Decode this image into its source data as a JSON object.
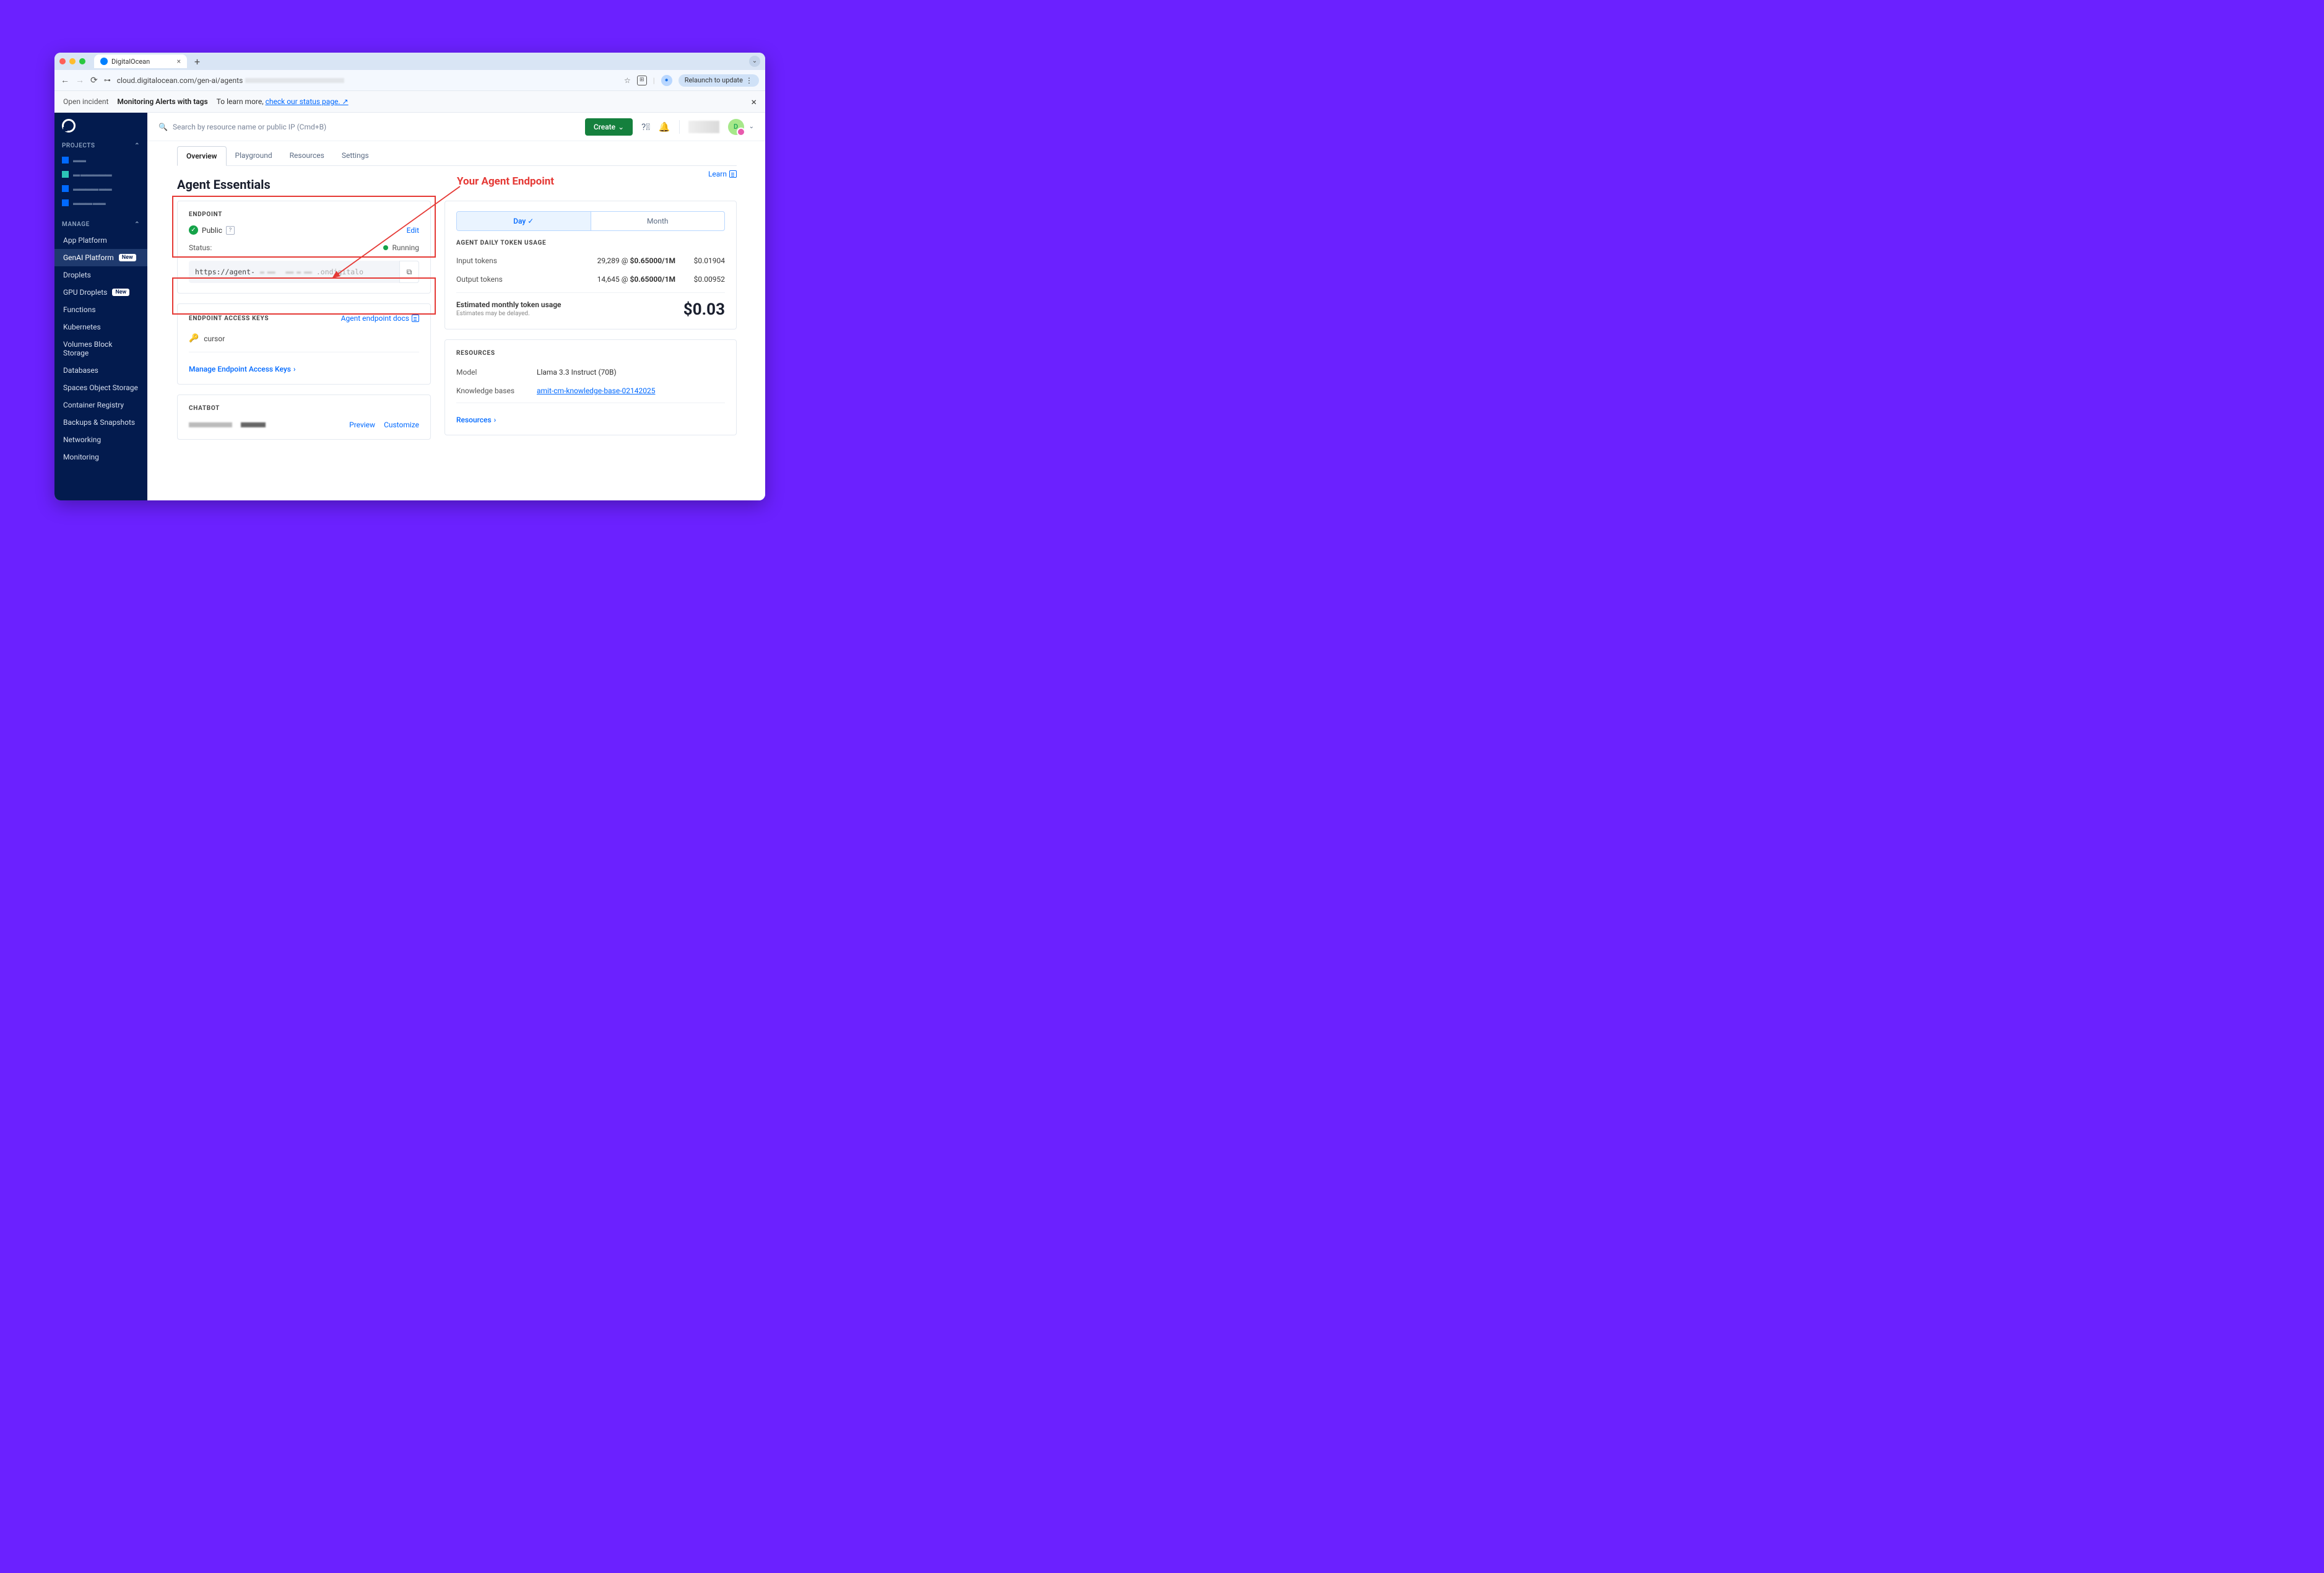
{
  "chrome": {
    "tab_title": "DigitalOcean",
    "url": "cloud.digitalocean.com/gen-ai/agents",
    "relaunch": "Relaunch to update"
  },
  "banner": {
    "open_incident": "Open incident",
    "title": "Monitoring Alerts with tags",
    "learn_more": "To learn more,",
    "status_link": "check our status page."
  },
  "topbar": {
    "search_placeholder": "Search by resource name or public IP (Cmd+B)",
    "create": "Create",
    "avatar_initial": "D"
  },
  "sidebar": {
    "projects_hdr": "PROJECTS",
    "manage_hdr": "MANAGE",
    "manage": [
      {
        "label": "App Platform"
      },
      {
        "label": "GenAI Platform",
        "new": true,
        "active": true
      },
      {
        "label": "Droplets"
      },
      {
        "label": "GPU Droplets",
        "new": true
      },
      {
        "label": "Functions"
      },
      {
        "label": "Kubernetes"
      },
      {
        "label": "Volumes Block Storage"
      },
      {
        "label": "Databases"
      },
      {
        "label": "Spaces Object Storage"
      },
      {
        "label": "Container Registry"
      },
      {
        "label": "Backups & Snapshots"
      },
      {
        "label": "Networking"
      },
      {
        "label": "Monitoring"
      }
    ]
  },
  "tabs": {
    "overview": "Overview",
    "playground": "Playground",
    "resources": "Resources",
    "settings": "Settings"
  },
  "page_title": "Agent Essentials",
  "learn": "Learn",
  "endpoint": {
    "hdr": "ENDPOINT",
    "public": "Public",
    "edit": "Edit",
    "status_label": "Status:",
    "status_val": "Running",
    "url_pre": "https://agent-",
    "url_suf": ".ondigitalo"
  },
  "access_keys": {
    "hdr": "ENDPOINT ACCESS KEYS",
    "docs": "Agent endpoint docs",
    "key1": "cursor",
    "manage": "Manage Endpoint Access Keys"
  },
  "chatbot": {
    "hdr": "CHATBOT",
    "preview": "Preview",
    "customize": "Customize"
  },
  "usage": {
    "seg_day": "Day",
    "seg_month": "Month",
    "hdr": "AGENT DAILY TOKEN USAGE",
    "rows": [
      {
        "l": "Input tokens",
        "m": "29,289 @ $0.65000/1M",
        "r": "$0.01904"
      },
      {
        "l": "Output tokens",
        "m": "14,645 @ $0.65000/1M",
        "r": "$0.00952"
      }
    ],
    "est_label": "Estimated monthly token usage",
    "est_sub": "Estimates may be delayed.",
    "total": "$0.03"
  },
  "resources": {
    "hdr": "RESOURCES",
    "rows": [
      {
        "k": "Model",
        "v": "Llama 3.3 Instruct (70B)"
      },
      {
        "k": "Knowledge bases",
        "v": "amit-cm-knowledge-base-02142025",
        "link": true
      }
    ],
    "more": "Resources"
  },
  "annotation": "Your Agent Endpoint"
}
